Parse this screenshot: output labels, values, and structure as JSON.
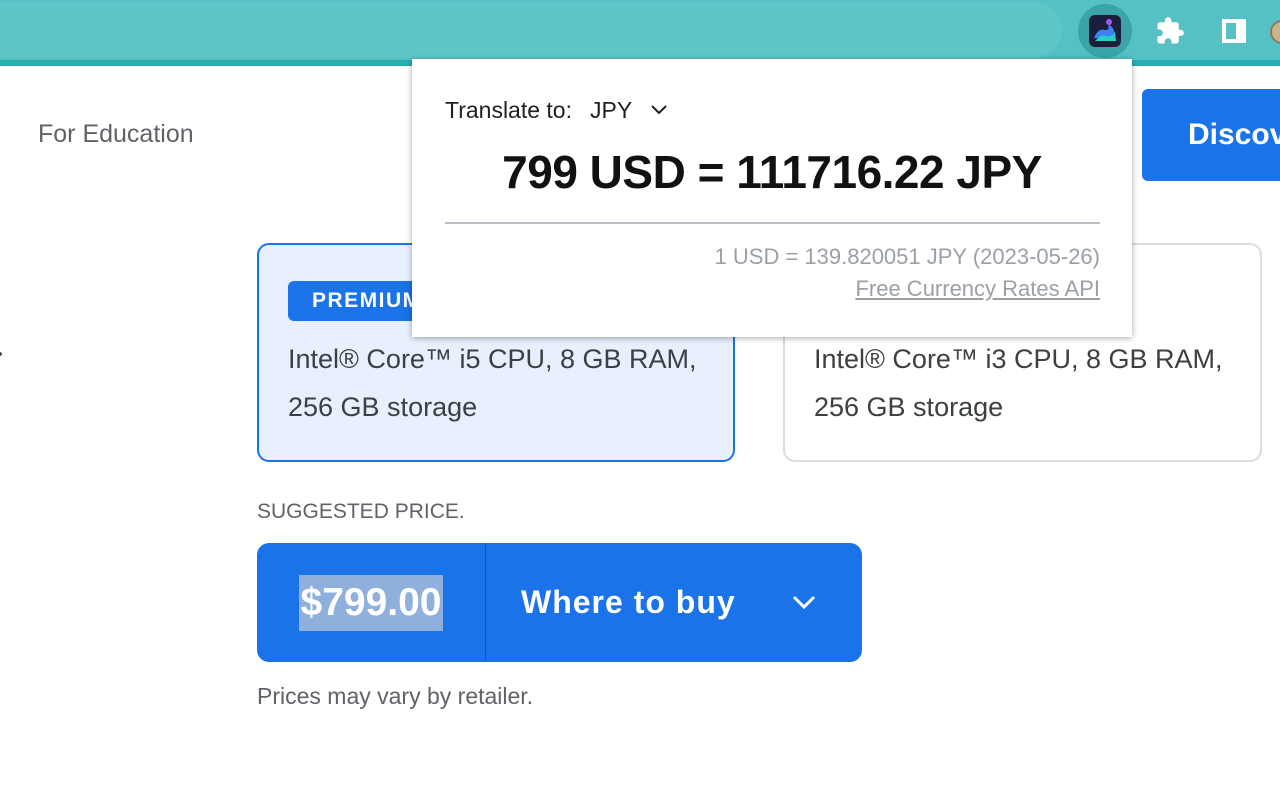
{
  "browser": {
    "toolbar_color": "#55c1c4",
    "extensions": [
      {
        "icon": "currency-translator-extension-icon",
        "active": true
      },
      {
        "icon": "puzzle-icon"
      },
      {
        "icon": "side-panel-icon"
      }
    ]
  },
  "page": {
    "nav_label": "For Education",
    "discover_button": "Discov",
    "options": [
      {
        "badge": "PREMIUM",
        "spec": "Intel® Core™ i5 CPU, 8 GB RAM, 256 GB storage",
        "selected": true
      },
      {
        "spec": "Intel® Core™ i3 CPU, 8 GB RAM, 256 GB storage",
        "selected": false
      }
    ],
    "suggested_price_label": "SUGGESTED PRICE.",
    "price": "$799.00",
    "where_to_buy": "Where to buy",
    "disclaimer": "Prices may vary by retailer.",
    "accent_color": "#1a73e8"
  },
  "popup": {
    "translate_label": "Translate to:",
    "currency": "JPY",
    "conversion": "799 USD = 111716.22 JPY",
    "rate": "1 USD = 139.820051 JPY (2023-05-26)",
    "api_link": "Free Currency Rates API"
  }
}
